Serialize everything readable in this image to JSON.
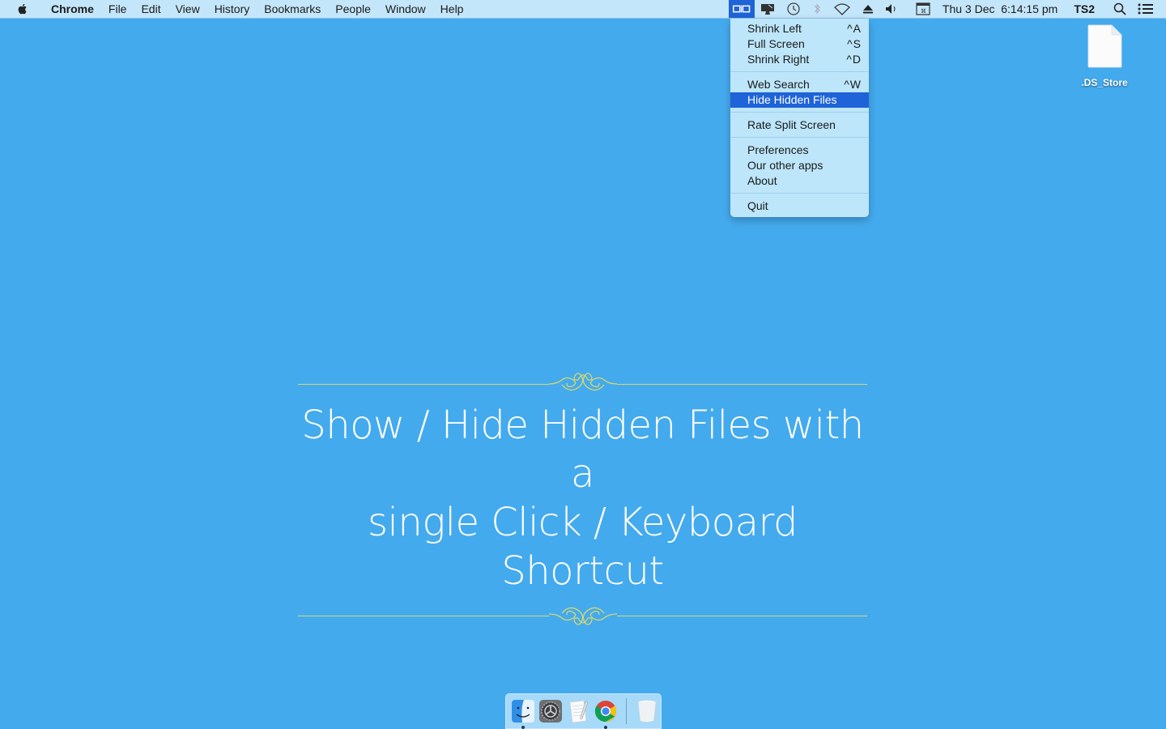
{
  "menubar": {
    "apple_icon": "apple-logo",
    "app_name": "Chrome",
    "menus": [
      "File",
      "Edit",
      "View",
      "History",
      "Bookmarks",
      "People",
      "Window",
      "Help"
    ],
    "status_icons": [
      "split-screen-icon",
      "display-icon",
      "time-machine-icon",
      "bluetooth-icon",
      "wifi-icon",
      "eject-icon",
      "volume-icon",
      "keyboard-input-icon"
    ],
    "clock": "Thu 3 Dec  6:14:15 pm",
    "user": "TS2",
    "spotlight_icon": "search-icon",
    "notification_icon": "list-icon"
  },
  "dropdown": {
    "groups": [
      [
        {
          "label": "Shrink Left",
          "shortcut": "^A"
        },
        {
          "label": "Full Screen",
          "shortcut": "^S"
        },
        {
          "label": "Shrink Right",
          "shortcut": "^D"
        }
      ],
      [
        {
          "label": "Web Search",
          "shortcut": "^W"
        },
        {
          "label": "Hide Hidden Files",
          "shortcut": "",
          "highlighted": true
        }
      ],
      [
        {
          "label": "Rate Split Screen",
          "shortcut": ""
        }
      ],
      [
        {
          "label": "Preferences",
          "shortcut": ""
        },
        {
          "label": "Our other apps",
          "shortcut": ""
        },
        {
          "label": "About",
          "shortcut": ""
        }
      ],
      [
        {
          "label": "Quit",
          "shortcut": ""
        }
      ]
    ]
  },
  "desktop": {
    "file": {
      "name": ".DS_Store",
      "icon": "document-icon"
    }
  },
  "banner": {
    "line1": "Show / Hide Hidden Files with a",
    "line2": "single Click / Keyboard Shortcut"
  },
  "dock": {
    "apps": [
      {
        "name": "Finder",
        "icon": "finder-icon",
        "running": true
      },
      {
        "name": "System Preferences",
        "icon": "system-preferences-icon",
        "running": false
      },
      {
        "name": "TextEdit",
        "icon": "textedit-icon",
        "running": false
      },
      {
        "name": "Chrome",
        "icon": "chrome-icon",
        "running": true
      }
    ],
    "trash": {
      "name": "Trash",
      "icon": "trash-icon"
    }
  },
  "colors": {
    "desktop_bg": "#44aaee",
    "menubar_bg": "#c4e6fb",
    "highlight": "#1f63d8",
    "ornament": "#d8d86a"
  }
}
